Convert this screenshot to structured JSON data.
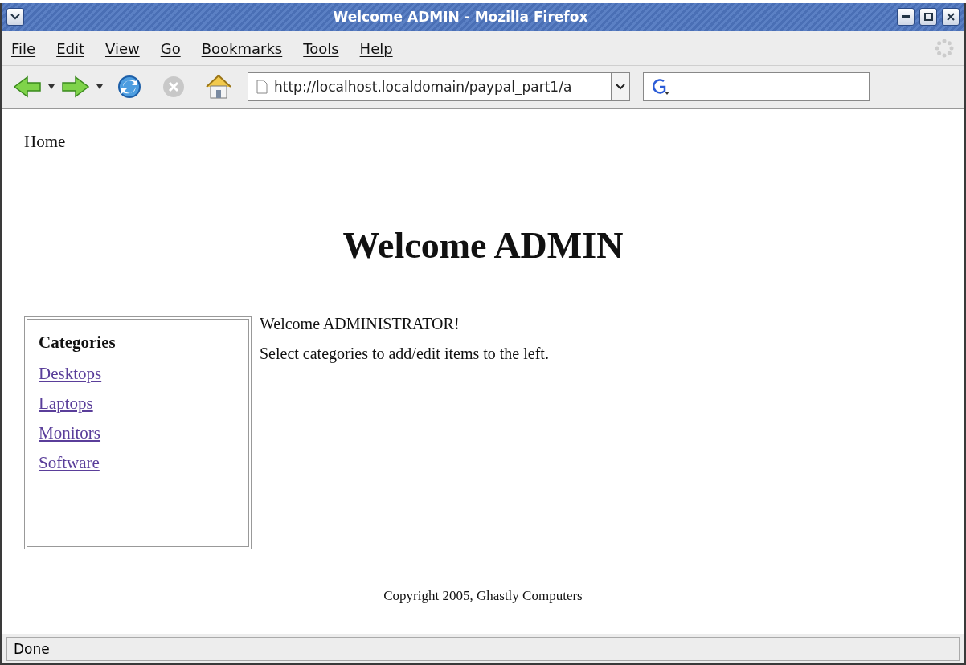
{
  "window": {
    "title": "Welcome ADMIN - Mozilla Firefox"
  },
  "menu": [
    "File",
    "Edit",
    "View",
    "Go",
    "Bookmarks",
    "Tools",
    "Help"
  ],
  "toolbar": {
    "back_disabled": false,
    "forward_disabled": false,
    "stop_disabled": true,
    "address": "http://localhost.localdomain/paypal_part1/a"
  },
  "page": {
    "breadcrumb": "Home",
    "heading": "Welcome ADMIN",
    "sidebar": {
      "title": "Categories",
      "links": [
        "Desktops",
        "Laptops",
        "Monitors",
        "Software"
      ]
    },
    "paragraphs": [
      "Welcome ADMINISTRATOR!",
      "Select categories to add/edit items to the left."
    ],
    "footer": "Copyright 2005, Ghastly Computers"
  },
  "status_bar": "Done"
}
